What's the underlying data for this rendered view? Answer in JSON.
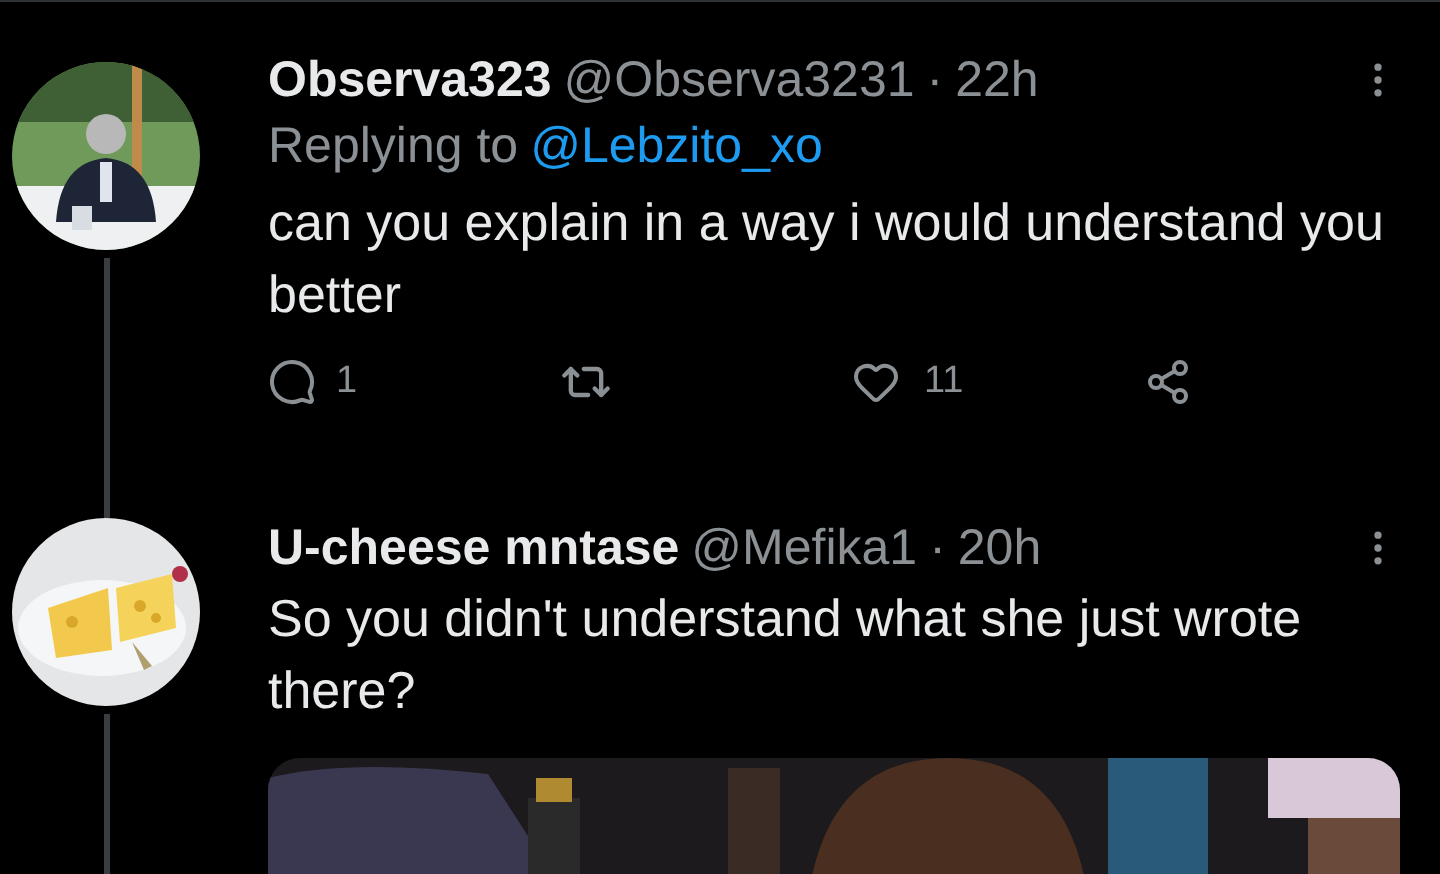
{
  "tweets": [
    {
      "name": "Observa323",
      "handle": "@Observa3231",
      "dot": "·",
      "time": "22h",
      "reply_label": "Replying to",
      "reply_to": "@Lebzito_xo",
      "text": "can you explain in a way i would understand you better",
      "actions": {
        "replies": "1",
        "likes": "11"
      }
    },
    {
      "name": "U-cheese mntase",
      "handle": "@Mefika1",
      "dot": "·",
      "time": "20h",
      "text": "So you didn't understand what she just wrote there?"
    }
  ]
}
